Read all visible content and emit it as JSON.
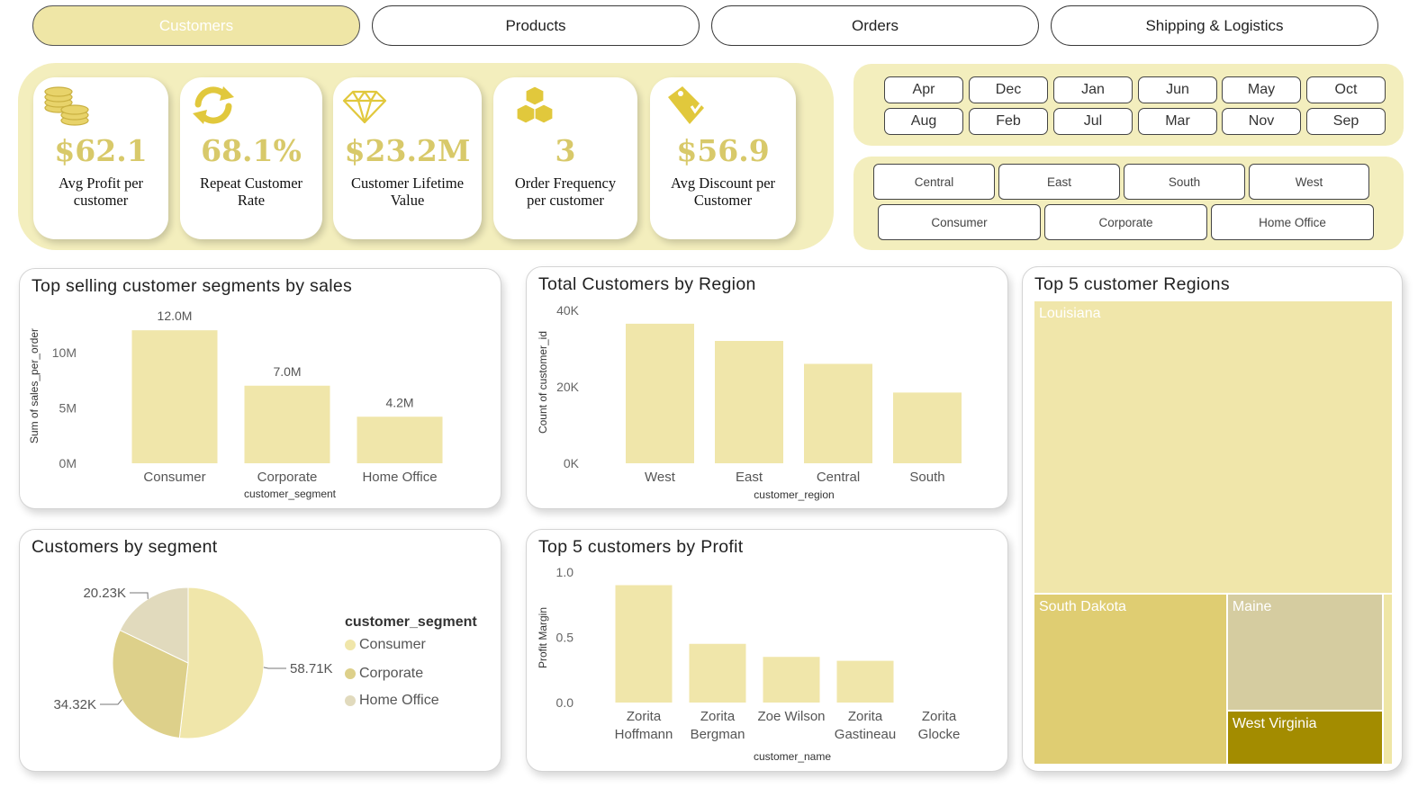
{
  "nav": {
    "tabs": [
      {
        "label": "Customers",
        "active": true
      },
      {
        "label": "Products",
        "active": false
      },
      {
        "label": "Orders",
        "active": false
      },
      {
        "label": "Shipping & Logistics",
        "active": false
      }
    ]
  },
  "kpis": [
    {
      "icon": "coins-icon",
      "value": "$62.1",
      "label_line1": "Avg Profit per",
      "label_line2": "customer"
    },
    {
      "icon": "refresh-icon",
      "value": "68.1%",
      "label_line1": "Repeat Customer",
      "label_line2": "Rate"
    },
    {
      "icon": "diamond-icon",
      "value": "$23.2M",
      "label_line1": "Customer Lifetime",
      "label_line2": "Value"
    },
    {
      "icon": "boxes-icon",
      "value": "3",
      "label_line1": "Order Frequency",
      "label_line2": "per customer"
    },
    {
      "icon": "money-tag-icon",
      "value": "$56.9",
      "label_line1": "Avg Discount per",
      "label_line2": "Customer"
    }
  ],
  "month_slicer": [
    "Apr",
    "Dec",
    "Jan",
    "Jun",
    "May",
    "Oct",
    "Aug",
    "Feb",
    "Jul",
    "Mar",
    "Nov",
    "Sep"
  ],
  "region_slicer": [
    "Central",
    "East",
    "South",
    "West"
  ],
  "segment_slicer": [
    "Consumer",
    "Corporate",
    "Home Office"
  ],
  "colors": {
    "accent": "#efe6a6",
    "panel": "#f3eebd",
    "kpi_value": "#d8c96a",
    "bar": "#f0e6aa",
    "pie": [
      "#f0e6aa",
      "#ddd08a",
      "#e1dabd"
    ],
    "treemap": [
      "#f0e6aa",
      "#dfcd72",
      "#d5cca0",
      "#a38c00",
      "#efe6a6"
    ]
  },
  "chart_data": [
    {
      "id": "segments_sales",
      "type": "bar",
      "title": "Top selling customer segments by sales",
      "xlabel": "customer_segment",
      "ylabel": "Sum of sales_per_order",
      "categories": [
        "Consumer",
        "Corporate",
        "Home Office"
      ],
      "values": [
        12.0,
        7.0,
        4.2
      ],
      "data_labels": [
        "12.0M",
        "7.0M",
        "4.2M"
      ],
      "yticks": [
        "0M",
        "5M",
        "10M"
      ],
      "ytick_values": [
        0,
        5,
        10
      ],
      "ylim": [
        0,
        12.5
      ]
    },
    {
      "id": "customers_region",
      "type": "bar",
      "title": "Total Customers by Region",
      "xlabel": "customer_region",
      "ylabel": "Count of customer_id",
      "categories": [
        "West",
        "East",
        "Central",
        "South"
      ],
      "values": [
        36500,
        32000,
        26000,
        18500
      ],
      "yticks": [
        "0K",
        "20K",
        "40K"
      ],
      "ytick_values": [
        0,
        20000,
        40000
      ],
      "ylim": [
        0,
        40000
      ]
    },
    {
      "id": "customers_segment_pie",
      "type": "pie",
      "title": "Customers by segment",
      "legend_title": "customer_segment",
      "legend": "right",
      "categories": [
        "Consumer",
        "Corporate",
        "Home Office"
      ],
      "values": [
        58.71,
        34.32,
        20.23
      ],
      "data_labels": [
        "58.71K",
        "34.32K",
        "20.23K"
      ]
    },
    {
      "id": "top5_profit",
      "type": "bar",
      "title": "Top 5 customers by Profit",
      "xlabel": "customer_name",
      "ylabel": "Profit Margin",
      "categories": [
        [
          "Zorita",
          "Hoffmann"
        ],
        [
          "Zorita",
          "Bergman"
        ],
        [
          "Zoe Wilson"
        ],
        [
          "Zorita",
          "Gastineau"
        ],
        [
          "Zorita",
          "Glocke"
        ]
      ],
      "values": [
        0.9,
        0.45,
        0.35,
        0.32,
        0.0
      ],
      "yticks": [
        "0.0",
        "0.5",
        "1.0"
      ],
      "ytick_values": [
        0,
        0.5,
        1.0
      ],
      "ylim": [
        0,
        1.0
      ]
    },
    {
      "id": "top5_regions_treemap",
      "type": "treemap",
      "title": "Top 5 customer Regions",
      "categories": [
        "Louisiana",
        "South Dakota",
        "Maine",
        "West Virginia",
        ""
      ],
      "values": [
        49.2,
        15.4,
        8.5,
        3.9,
        0.8
      ]
    }
  ]
}
